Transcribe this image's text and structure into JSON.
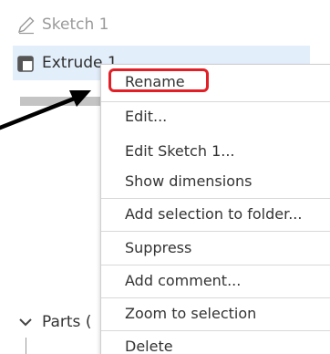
{
  "tree": {
    "sketch_label": "Sketch 1",
    "extrude_label": "Extrude 1",
    "parts_label": "Parts ("
  },
  "menu": {
    "items": [
      "Rename",
      "Edit...",
      "Edit Sketch 1...",
      "Show dimensions",
      "Add selection to folder...",
      "Suppress",
      "Add comment...",
      "Zoom to selection",
      "Delete"
    ]
  },
  "colors": {
    "selection_bg": "#e3eefb",
    "highlight_red": "#e21f26",
    "text": "#333333",
    "muted_text": "#9a9a9a"
  },
  "icons": {
    "sketch": "pencil-icon",
    "extrude": "part-studio-feature-icon",
    "parts_toggle": "chevron-down-icon",
    "annotation": "arrow-icon"
  }
}
